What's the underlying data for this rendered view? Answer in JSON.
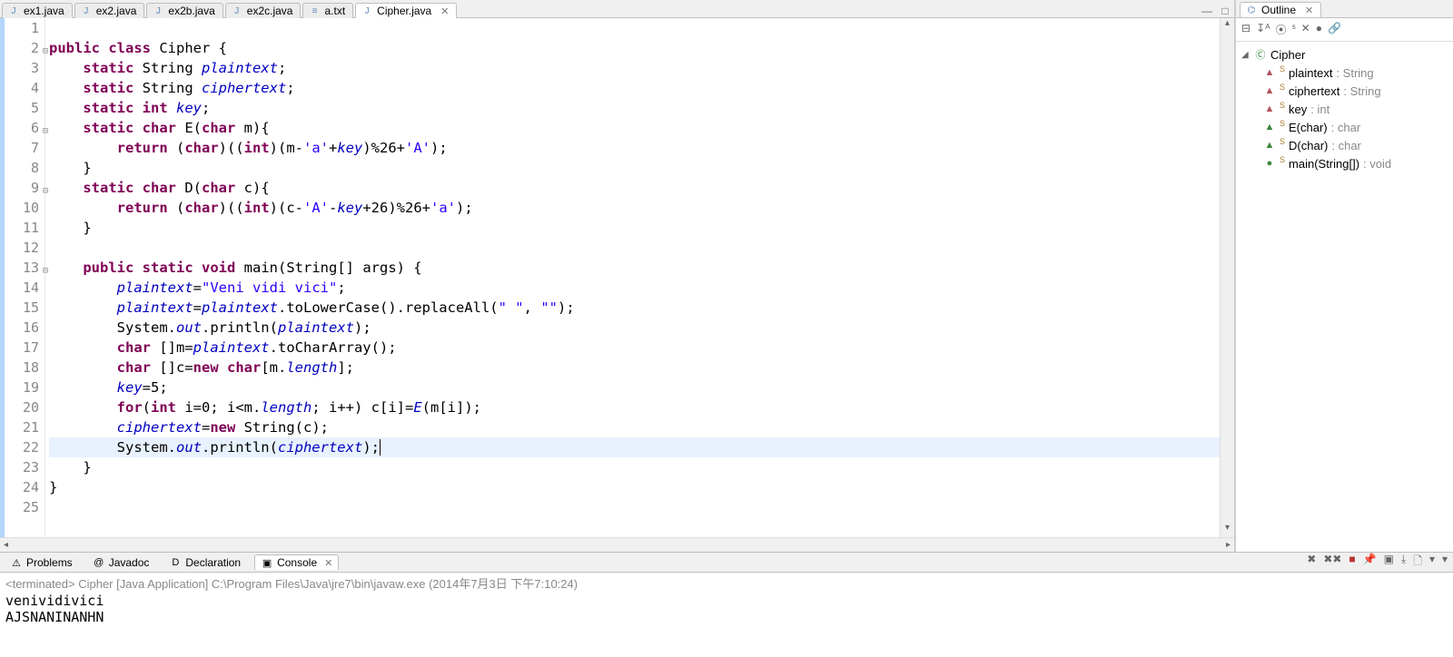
{
  "editor_tabs": [
    {
      "label": "ex1.java",
      "icon": "J"
    },
    {
      "label": "ex2.java",
      "icon": "J"
    },
    {
      "label": "ex2b.java",
      "icon": "J"
    },
    {
      "label": "ex2c.java",
      "icon": "J"
    },
    {
      "label": "a.txt",
      "icon": "≡"
    },
    {
      "label": "Cipher.java",
      "icon": "J",
      "active": true,
      "closeable": true
    }
  ],
  "code_lines": [
    {
      "n": 1,
      "html": ""
    },
    {
      "n": 2,
      "html": "<span class='kw'>public</span> <span class='kw'>class</span> Cipher {",
      "fold": true
    },
    {
      "n": 3,
      "html": "    <span class='kw'>static</span> String <span class='fld'>plaintext</span>;"
    },
    {
      "n": 4,
      "html": "    <span class='kw'>static</span> String <span class='fld'>ciphertext</span>;"
    },
    {
      "n": 5,
      "html": "    <span class='kw'>static</span> <span class='kw'>int</span> <span class='fld'>key</span>;"
    },
    {
      "n": 6,
      "html": "    <span class='kw'>static</span> <span class='kw'>char</span> E(<span class='kw'>char</span> m){",
      "fold": true
    },
    {
      "n": 7,
      "html": "        <span class='kw'>return</span> (<span class='kw'>char</span>)((<span class='kw'>int</span>)(m-<span class='str'>'a'</span>+<span class='fld'>key</span>)%26+<span class='str'>'A'</span>);"
    },
    {
      "n": 8,
      "html": "    }"
    },
    {
      "n": 9,
      "html": "    <span class='kw'>static</span> <span class='kw'>char</span> D(<span class='kw'>char</span> c){",
      "fold": true
    },
    {
      "n": 10,
      "html": "        <span class='kw'>return</span> (<span class='kw'>char</span>)((<span class='kw'>int</span>)(c-<span class='str'>'A'</span>-<span class='fld'>key</span>+26)%26+<span class='str'>'a'</span>);"
    },
    {
      "n": 11,
      "html": "    }"
    },
    {
      "n": 12,
      "html": ""
    },
    {
      "n": 13,
      "html": "    <span class='kw'>public</span> <span class='kw'>static</span> <span class='kw'>void</span> main(String[] args) {",
      "fold": true
    },
    {
      "n": 14,
      "html": "        <span class='fld'>plaintext</span>=<span class='str'>\"Veni vidi vici\"</span>;"
    },
    {
      "n": 15,
      "html": "        <span class='fld'>plaintext</span>=<span class='fld'>plaintext</span>.toLowerCase().replaceAll(<span class='str'>\" \"</span>, <span class='str'>\"\"</span>);"
    },
    {
      "n": 16,
      "html": "        System.<span class='fld'>out</span>.println(<span class='fld'>plaintext</span>);"
    },
    {
      "n": 17,
      "html": "        <span class='kw'>char</span> []m=<span class='fld'>plaintext</span>.toCharArray();"
    },
    {
      "n": 18,
      "html": "        <span class='kw'>char</span> []c=<span class='kw'>new</span> <span class='kw'>char</span>[m.<span class='fld'>length</span>];"
    },
    {
      "n": 19,
      "html": "        <span class='fld'>key</span>=5;"
    },
    {
      "n": 20,
      "html": "        <span class='kw'>for</span>(<span class='kw'>int</span> i=0; i&lt;m.<span class='fld'>length</span>; i++) c[i]=<span class='fld'>E</span>(m[i]);"
    },
    {
      "n": 21,
      "html": "        <span class='fld'>ciphertext</span>=<span class='kw'>new</span> String(c);"
    },
    {
      "n": 22,
      "html": "        System.<span class='fld'>out</span>.println(<span class='fld'>ciphertext</span>);<span class='cursor'></span>",
      "current": true
    },
    {
      "n": 23,
      "html": "    }"
    },
    {
      "n": 24,
      "html": "}"
    },
    {
      "n": 25,
      "html": ""
    }
  ],
  "outline": {
    "title": "Outline",
    "root": "Cipher",
    "children": [
      {
        "kind": "field",
        "name": "plaintext",
        "type": "String"
      },
      {
        "kind": "field",
        "name": "ciphertext",
        "type": "String"
      },
      {
        "kind": "field",
        "name": "key",
        "type": "int"
      },
      {
        "kind": "method",
        "name": "E(char)",
        "type": "char"
      },
      {
        "kind": "method",
        "name": "D(char)",
        "type": "char"
      },
      {
        "kind": "main",
        "name": "main(String[])",
        "type": "void"
      }
    ]
  },
  "bottom": {
    "tabs": [
      {
        "label": "Problems",
        "icon": "⚠"
      },
      {
        "label": "Javadoc",
        "icon": "@"
      },
      {
        "label": "Declaration",
        "icon": "D"
      },
      {
        "label": "Console",
        "icon": "▣",
        "active": true,
        "closeable": true
      }
    ],
    "console_header": "<terminated> Cipher [Java Application] C:\\Program Files\\Java\\jre7\\bin\\javaw.exe (2014年7月3日 下午7:10:24)",
    "console_output": [
      "venividivici",
      "AJSNANINANHN"
    ]
  }
}
